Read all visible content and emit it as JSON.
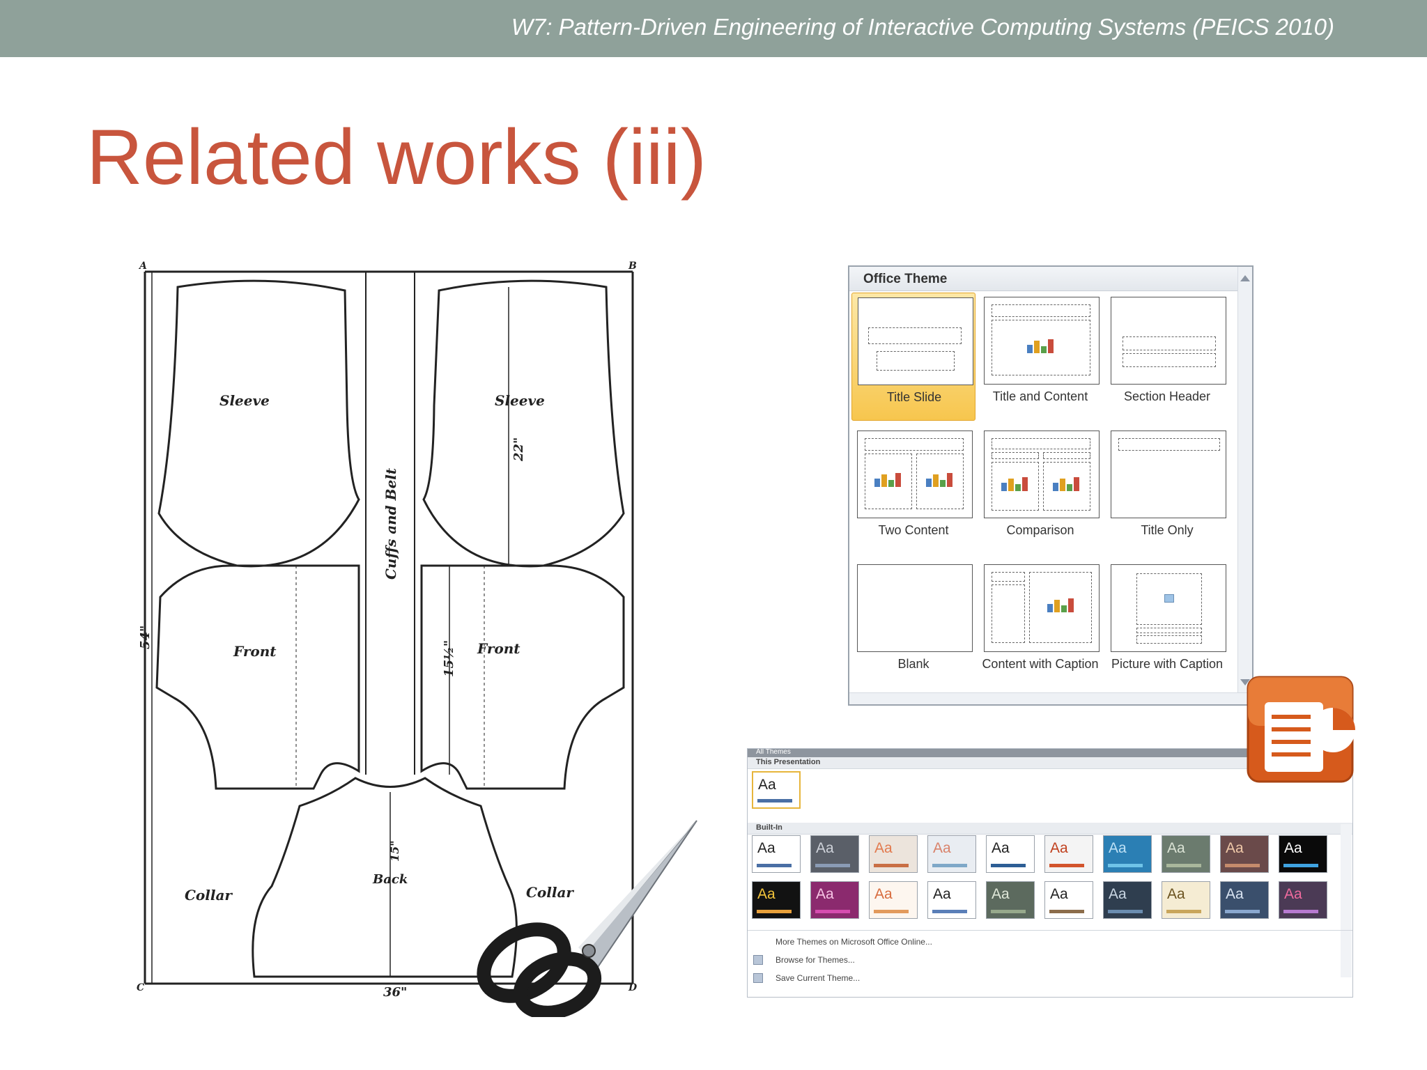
{
  "header": {
    "conference": "W7: Pattern-Driven Engineering of Interactive Computing Systems (PEICS 2010)"
  },
  "slide": {
    "title": "Related works (iii)"
  },
  "pattern": {
    "labels": {
      "a": "A",
      "b": "B",
      "c": "C",
      "d": "D",
      "sleeve_left": "Sleeve",
      "sleeve_right": "Sleeve",
      "cuffs": "Cuffs and Belt",
      "front_left": "Front",
      "front_right": "Front",
      "back": "Back",
      "collar_left": "Collar",
      "collar_right": "Collar",
      "dim_height": "54\"",
      "dim_width": "36\"",
      "dim_sleeve": "22\"",
      "dim_front": "15½\"",
      "dim_back": "15\""
    }
  },
  "layout_gallery": {
    "header": "Office Theme",
    "layouts": [
      {
        "label": "Title Slide",
        "selected": true
      },
      {
        "label": "Title and Content",
        "selected": false
      },
      {
        "label": "Section Header",
        "selected": false
      },
      {
        "label": "Two Content",
        "selected": false
      },
      {
        "label": "Comparison",
        "selected": false
      },
      {
        "label": "Title Only",
        "selected": false
      },
      {
        "label": "Blank",
        "selected": false
      },
      {
        "label": "Content with Caption",
        "selected": false
      },
      {
        "label": "Picture with Caption",
        "selected": false
      }
    ]
  },
  "themes_gallery": {
    "header": "All Themes",
    "this_presentation": "This Presentation",
    "built_in": "Built-In",
    "theme_glyph": "Aa",
    "commands": [
      "More Themes on Microsoft Office Online...",
      "Browse for Themes...",
      "Save Current Theme..."
    ],
    "current_theme": {
      "bg": "#ffffff",
      "fg": "#222222",
      "bar": "#4a6fa5"
    },
    "themes": [
      {
        "bg": "#ffffff",
        "fg": "#222222",
        "bar": "#4a6fa5"
      },
      {
        "bg": "#5a5f68",
        "fg": "#cfd3da",
        "bar": "#8a9bb5"
      },
      {
        "bg": "#ece4dc",
        "fg": "#e27a4e",
        "bar": "#c96f45"
      },
      {
        "bg": "#e9edf2",
        "fg": "#d9826a",
        "bar": "#7fa8c8"
      },
      {
        "bg": "#ffffff",
        "fg": "#222222",
        "bar": "#2d5e95"
      },
      {
        "bg": "#f4f4f4",
        "fg": "#c0401e",
        "bar": "#d2542c"
      },
      {
        "bg": "#2b7fb4",
        "fg": "#bde0f5",
        "bar": "#6fc3e8"
      },
      {
        "bg": "#6b7b6e",
        "fg": "#dbe3d5",
        "bar": "#a9b79c"
      },
      {
        "bg": "#6a4a4a",
        "fg": "#f0c9a9",
        "bar": "#c58b6c"
      },
      {
        "bg": "#0a0a0a",
        "fg": "#ffffff",
        "bar": "#3fa2e0"
      },
      {
        "bg": "#121212",
        "fg": "#f3c43b",
        "bar": "#e8a13c"
      },
      {
        "bg": "#8b2a6e",
        "fg": "#f7c5e5",
        "bar": "#d64db0"
      },
      {
        "bg": "#fdf6ef",
        "fg": "#d86c3e",
        "bar": "#e29a5c"
      },
      {
        "bg": "#ffffff",
        "fg": "#222222",
        "bar": "#5a7fb8"
      },
      {
        "bg": "#5c6a5e",
        "fg": "#dfe7d8",
        "bar": "#97a98c"
      },
      {
        "bg": "#ffffff",
        "fg": "#222222",
        "bar": "#8c6d4b"
      },
      {
        "bg": "#2f3e4f",
        "fg": "#c9d6e3",
        "bar": "#6b8db0"
      },
      {
        "bg": "#f5ecd3",
        "fg": "#6b5320",
        "bar": "#c9a65c"
      },
      {
        "bg": "#3a4f6c",
        "fg": "#d8e3f1",
        "bar": "#8aa8cf"
      },
      {
        "bg": "#4b3a55",
        "fg": "#f06a9e",
        "bar": "#b77ad1"
      }
    ]
  }
}
